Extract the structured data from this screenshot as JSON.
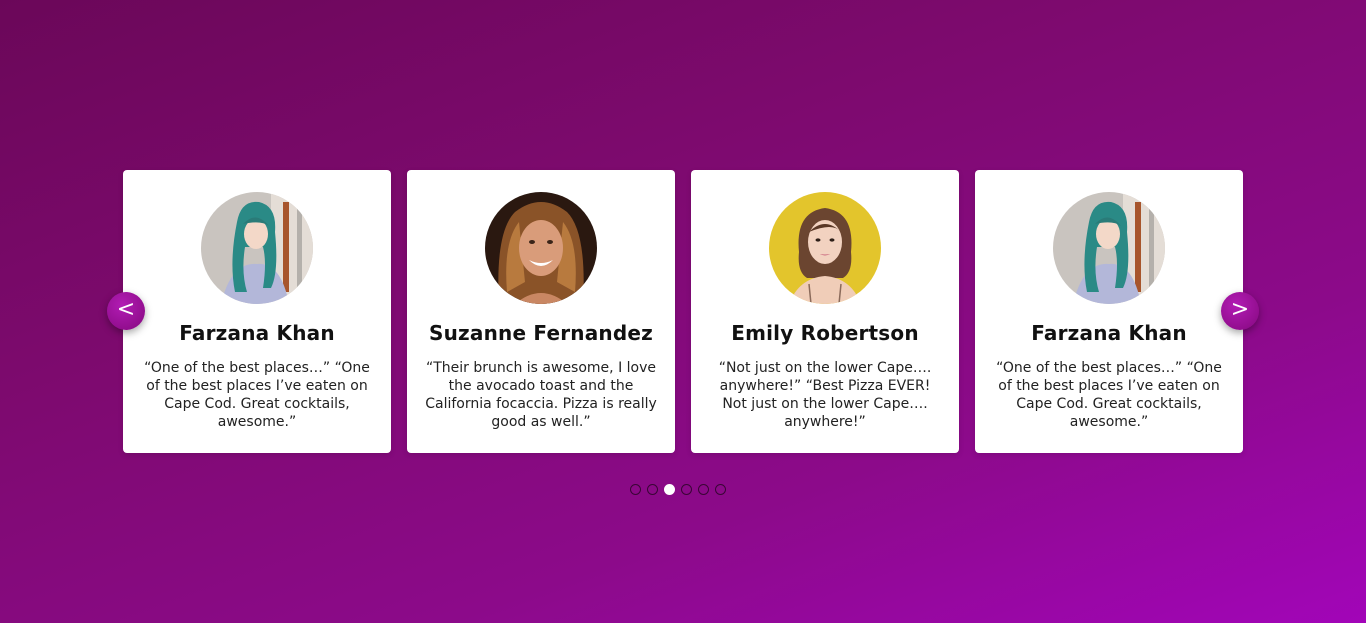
{
  "carousel": {
    "prev_label": "<",
    "next_label": ">",
    "cards": [
      {
        "name": "Farzana Khan",
        "quote": "“One of the best places…” “One of the best places I’ve eaten on Cape Cod. Great cocktails, awesome.”",
        "avatar": "farzana-photo"
      },
      {
        "name": "Suzanne Fernandez",
        "quote": "“Their brunch is awesome, I love the avocado toast and the California focaccia. Pizza is really good as well.”",
        "avatar": "suzanne-photo"
      },
      {
        "name": "Emily Robertson",
        "quote": "“Not just on the lower Cape…. anywhere!” “Best Pizza EVER! Not just on the lower Cape…. anywhere!”",
        "avatar": "emily-photo"
      },
      {
        "name": "Farzana Khan",
        "quote": "“One of the best places…” “One of the best places I’ve eaten on Cape Cod. Great cocktails, awesome.”",
        "avatar": "farzana-photo"
      }
    ],
    "dots_count": 6,
    "active_dot": 3
  },
  "colors": {
    "accent": "#9a12a0",
    "card": "#ffffff"
  }
}
